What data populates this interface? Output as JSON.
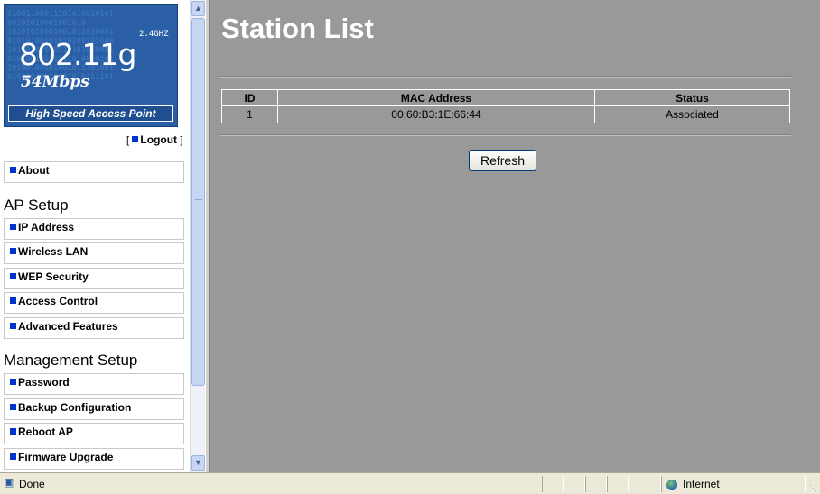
{
  "logo": {
    "binary": "01001100011101010010101\n00101010001001010\n10101010001001011010001\n01010100101010100101000\n10100101010110101010001\n01010010101011010010101\n10100100101001011101001\n01001010110101010111101",
    "model": "802.11g",
    "band": "2.4GHZ",
    "speed": "54Mbps",
    "caption": "High Speed Access Point"
  },
  "logout": {
    "open": "[",
    "label": "Logout",
    "close": "]"
  },
  "menu": {
    "about": "About",
    "ap_setup_heading": "AP Setup",
    "ap_setup": [
      "IP Address",
      "Wireless LAN",
      "WEP Security",
      "Access Control",
      "Advanced Features"
    ],
    "management_heading": "Management Setup",
    "management": [
      "Password",
      "Backup Configuration",
      "Reboot AP",
      "Firmware Upgrade"
    ]
  },
  "main": {
    "title": "Station List",
    "table": {
      "headers": [
        "ID",
        "MAC Address",
        "Status"
      ],
      "rows": [
        [
          "1",
          "00:60:B3:1E:66:44",
          "Associated"
        ]
      ]
    },
    "refresh_label": "Refresh"
  },
  "statusbar": {
    "text": "Done",
    "zone": "Internet"
  },
  "colors": {
    "page_bg": "#999999",
    "logo_bg": "#2a5fa5",
    "bullet": "#0033cc"
  },
  "icons": {
    "bullet": "square-bullet-icon",
    "done": "ie-page-icon",
    "zone": "globe-icon"
  }
}
